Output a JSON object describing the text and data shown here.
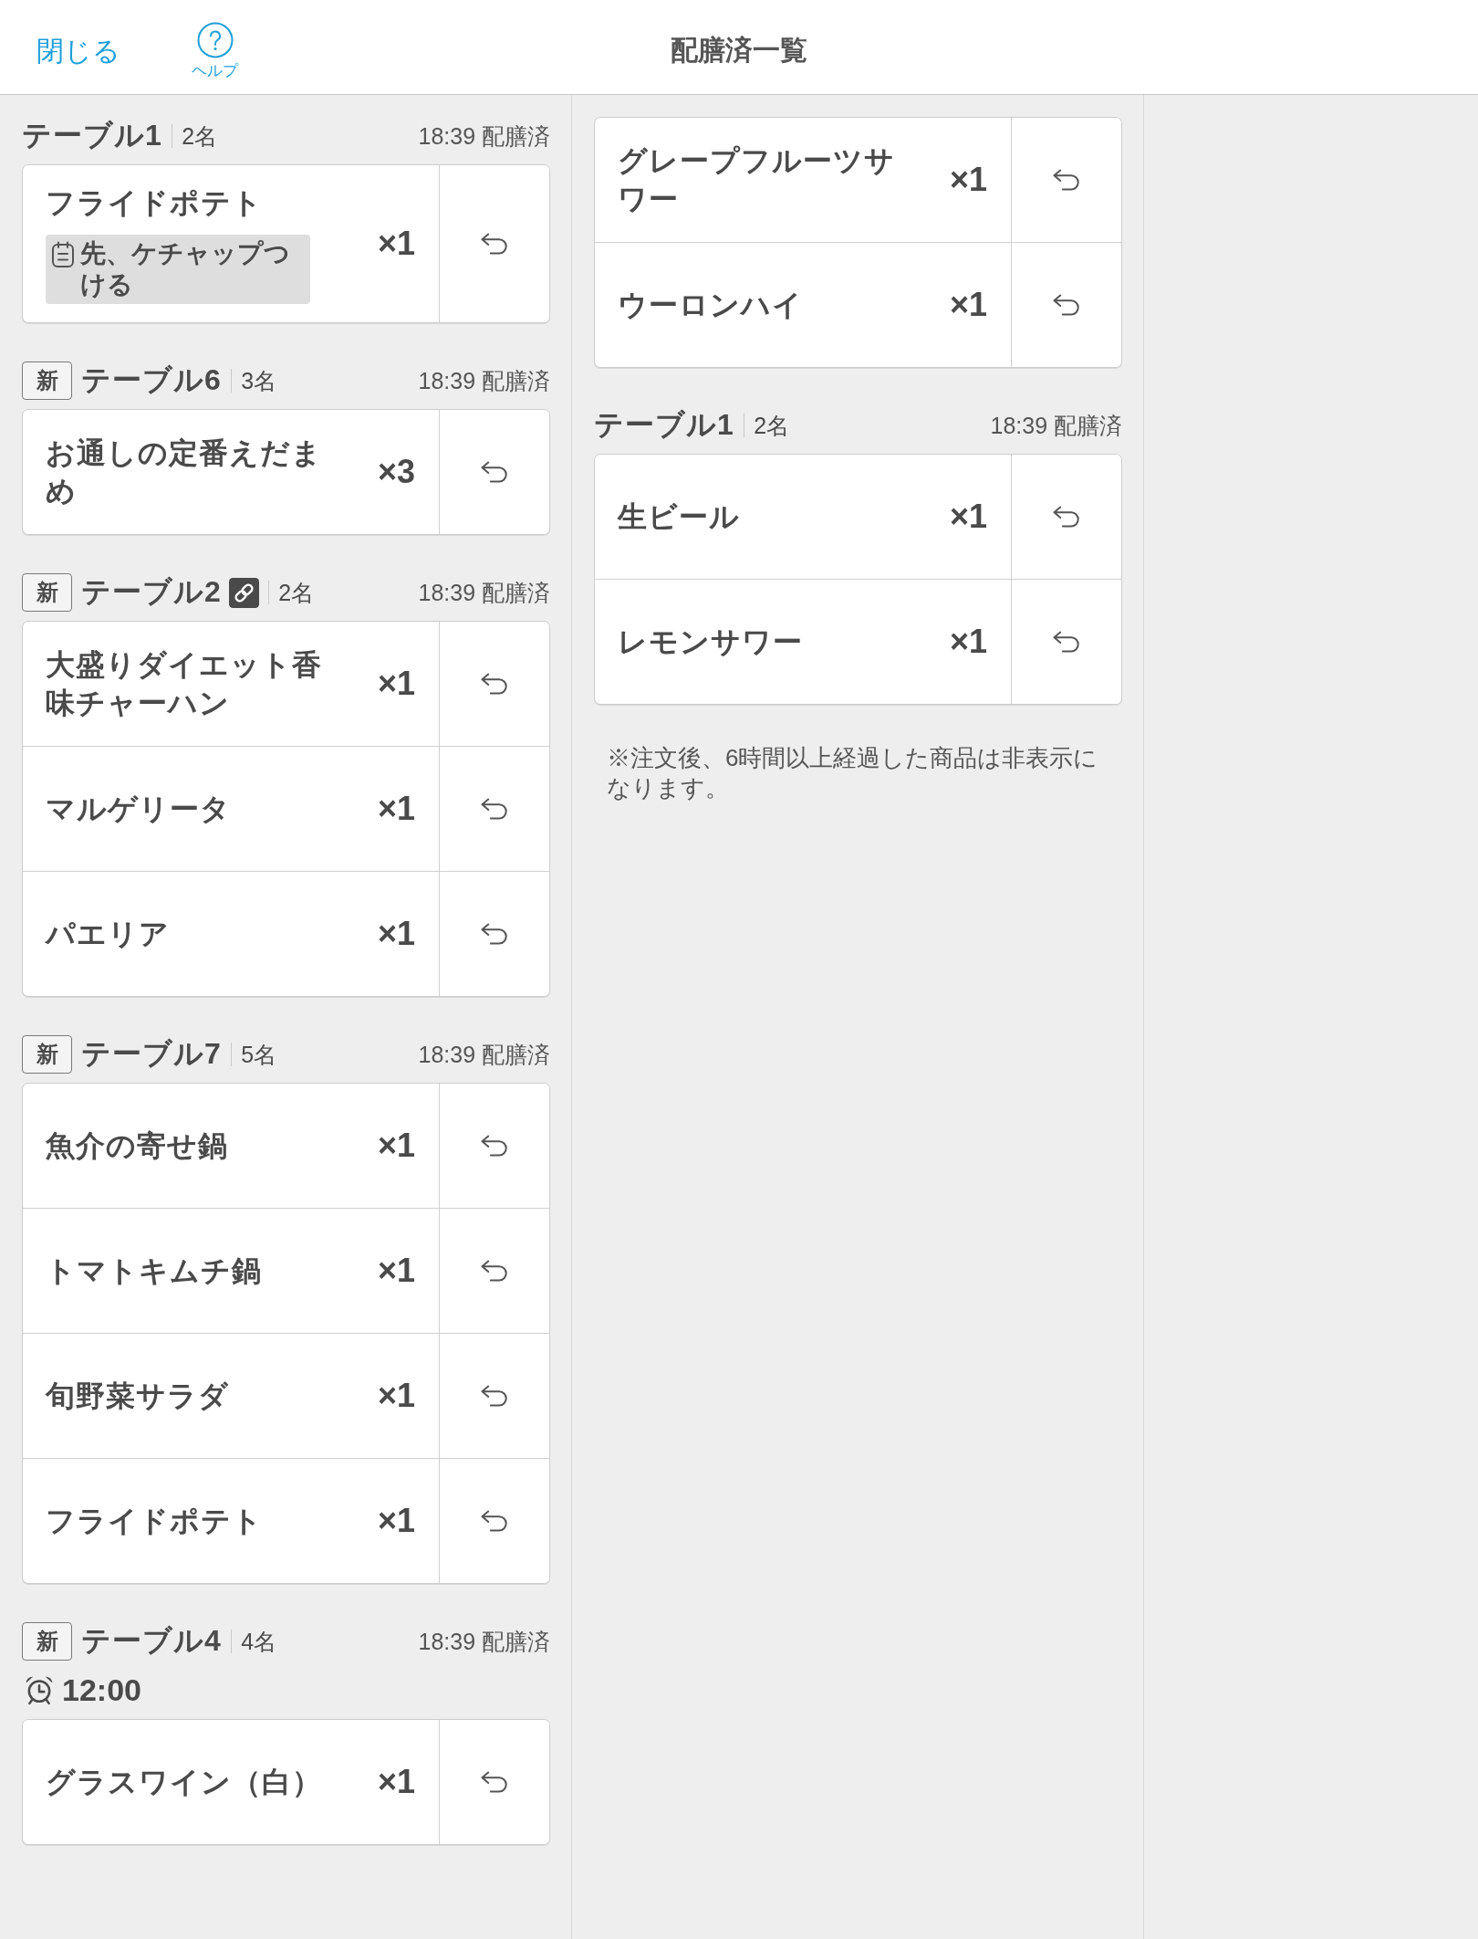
{
  "header": {
    "close": "閉じる",
    "help": "ヘルプ",
    "title": "配膳済一覧"
  },
  "columns": [
    {
      "groups": [
        {
          "kind": "table",
          "table": "テーブル1",
          "linked": false,
          "guests": "2名",
          "served": "18:39 配膳済",
          "items": [
            {
              "name": "フライドポテト",
              "note": "先、ケチャップつける",
              "quantity": "×1"
            }
          ]
        },
        {
          "kind": "table",
          "badge": "新",
          "table": "テーブル6",
          "linked": false,
          "guests": "3名",
          "served": "18:39 配膳済",
          "items": [
            {
              "name": "お通しの定番えだまめ",
              "quantity": "×3"
            }
          ]
        },
        {
          "kind": "table",
          "badge": "新",
          "table": "テーブル2",
          "linked": true,
          "guests": "2名",
          "served": "18:39 配膳済",
          "items": [
            {
              "name": "大盛りダイエット香味チャーハン",
              "quantity": "×1"
            },
            {
              "name": "マルゲリータ",
              "quantity": "×1"
            },
            {
              "name": "パエリア",
              "quantity": "×1"
            }
          ]
        },
        {
          "kind": "table",
          "badge": "新",
          "table": "テーブル7",
          "linked": false,
          "guests": "5名",
          "served": "18:39 配膳済",
          "items": [
            {
              "name": "魚介の寄せ鍋",
              "quantity": "×1"
            },
            {
              "name": "トマトキムチ鍋",
              "quantity": "×1"
            },
            {
              "name": "旬野菜サラダ",
              "quantity": "×1"
            },
            {
              "name": "フライドポテト",
              "quantity": "×1"
            }
          ]
        },
        {
          "kind": "table",
          "badge": "新",
          "table": "テーブル4",
          "linked": false,
          "guests": "4名",
          "served": "18:39 配膳済",
          "reserved_time": "12:00",
          "items": [
            {
              "name": "グラスワイン（白）",
              "quantity": "×1"
            }
          ]
        }
      ]
    },
    {
      "groups": [
        {
          "kind": "continuation",
          "items": [
            {
              "name": "グレープフルーツサワー",
              "quantity": "×1"
            },
            {
              "name": "ウーロンハイ",
              "quantity": "×1"
            }
          ]
        },
        {
          "kind": "table",
          "table": "テーブル1",
          "linked": false,
          "guests": "2名",
          "served": "18:39 配膳済",
          "items": [
            {
              "name": "生ビール",
              "quantity": "×1"
            },
            {
              "name": "レモンサワー",
              "quantity": "×1"
            }
          ]
        }
      ],
      "footnote": "※注文後、6時間以上経過した商品は非表示になります。"
    }
  ]
}
